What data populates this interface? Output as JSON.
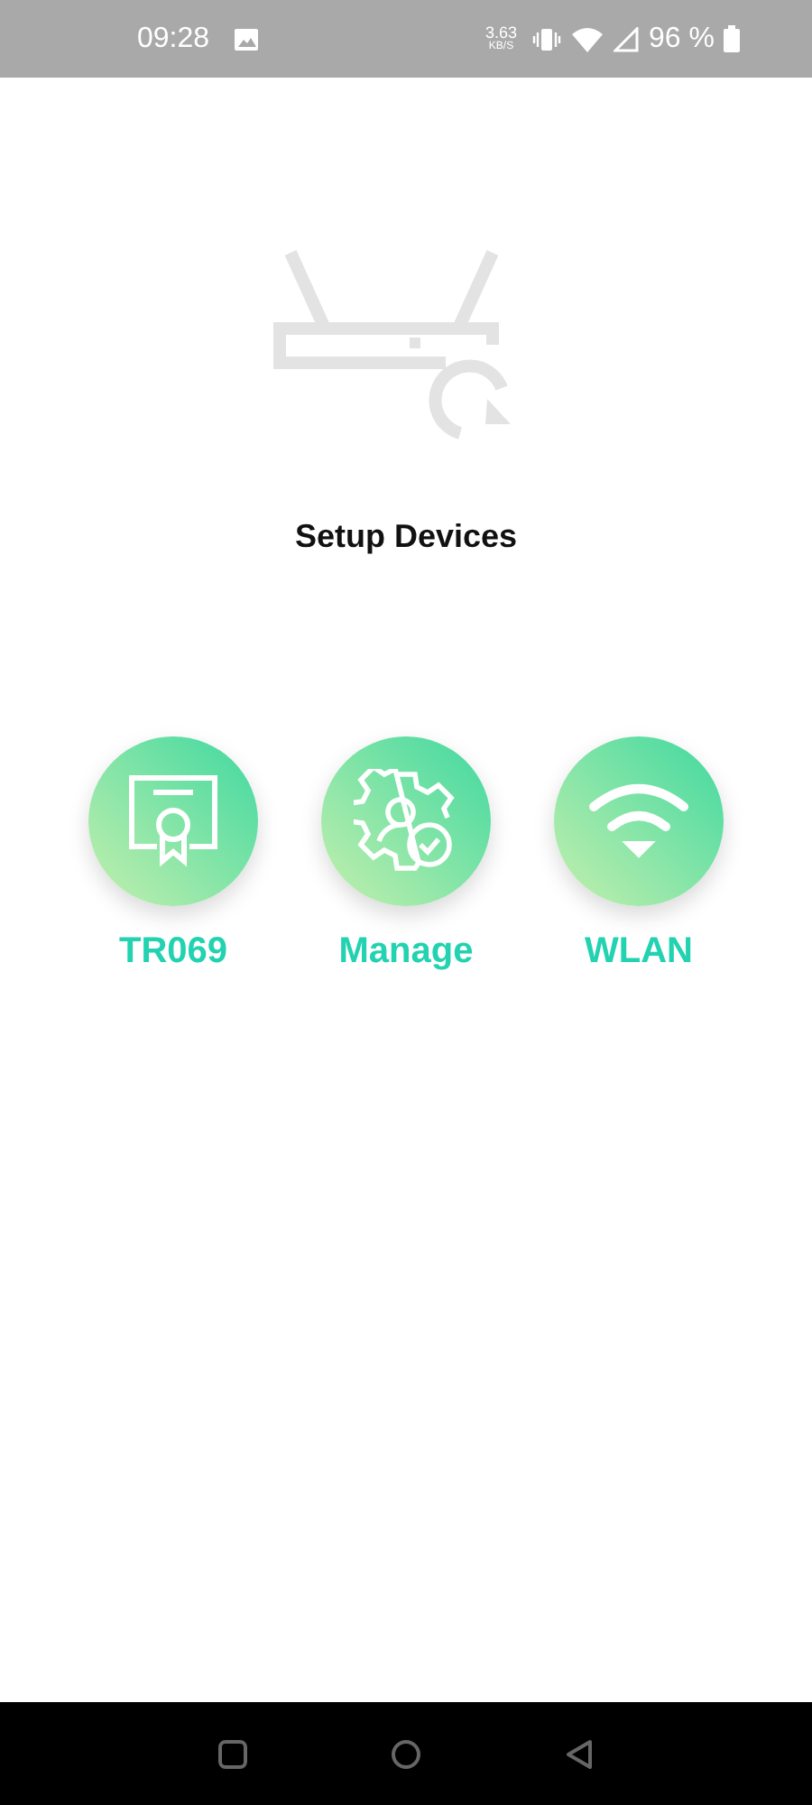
{
  "status_bar": {
    "time": "09:28",
    "net_speed": "3.63",
    "net_speed_unit": "KB/S",
    "battery": "96 %"
  },
  "title": "Setup Devices",
  "actions": [
    {
      "label": "TR069",
      "kind": "certificate"
    },
    {
      "label": "Manage",
      "kind": "gear"
    },
    {
      "label": "WLAN",
      "kind": "wifi"
    }
  ]
}
